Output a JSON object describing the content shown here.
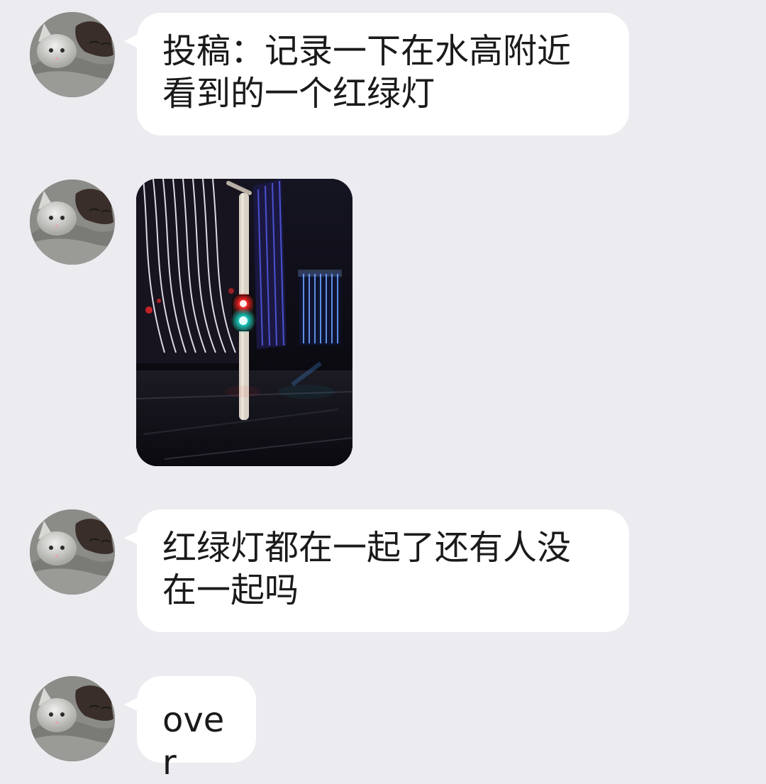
{
  "chat": {
    "messages": [
      {
        "type": "text",
        "avatar_icon": "cat-avatar-icon",
        "text": "投稿：记录一下在水高附近看到的一个红绿灯"
      },
      {
        "type": "image",
        "avatar_icon": "cat-avatar-icon",
        "image_icon": "night-street-traffic-light-image"
      },
      {
        "type": "text",
        "avatar_icon": "cat-avatar-icon",
        "text": "红绿灯都在一起了还有人没在一起吗"
      },
      {
        "type": "text",
        "avatar_icon": "cat-avatar-icon",
        "text": "over"
      }
    ]
  },
  "colors": {
    "background": "#ebebf0",
    "bubble": "#ffffff",
    "text": "#1a1a1a",
    "traffic_red": "#ff2a2a",
    "traffic_green": "#19d4c4"
  }
}
